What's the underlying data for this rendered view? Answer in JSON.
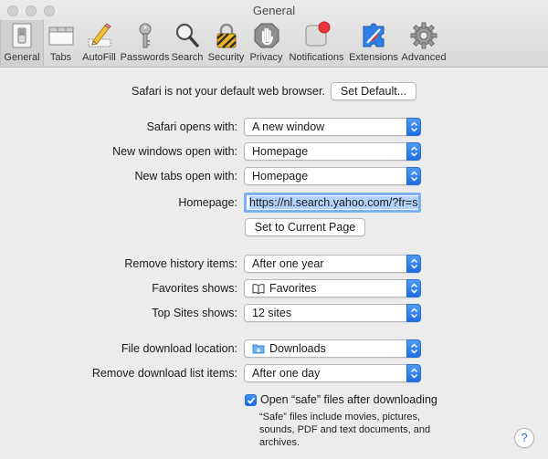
{
  "window": {
    "title": "General"
  },
  "toolbar": {
    "items": [
      {
        "label": "General",
        "icon": "general-switch-icon"
      },
      {
        "label": "Tabs",
        "icon": "tabs-icon"
      },
      {
        "label": "AutoFill",
        "icon": "autofill-pencil-icon"
      },
      {
        "label": "Passwords",
        "icon": "key-icon"
      },
      {
        "label": "Search",
        "icon": "magnifier-icon"
      },
      {
        "label": "Security",
        "icon": "padlock-icon"
      },
      {
        "label": "Privacy",
        "icon": "hand-icon"
      },
      {
        "label": "Notifications",
        "icon": "notification-badge-icon"
      },
      {
        "label": "Extensions",
        "icon": "puzzle-icon"
      },
      {
        "label": "Advanced",
        "icon": "gear-icon"
      }
    ]
  },
  "default_browser": {
    "message": "Safari is not your default web browser.",
    "button": "Set Default..."
  },
  "settings": {
    "opens_with": {
      "label": "Safari opens with:",
      "value": "A new window"
    },
    "new_windows": {
      "label": "New windows open with:",
      "value": "Homepage"
    },
    "new_tabs": {
      "label": "New tabs open with:",
      "value": "Homepage"
    },
    "homepage": {
      "label": "Homepage:",
      "value": "https://nl.search.yahoo.com/?fr=sp",
      "button": "Set to Current Page"
    },
    "remove_history": {
      "label": "Remove history items:",
      "value": "After one year"
    },
    "favorites_shows": {
      "label": "Favorites shows:",
      "value": "Favorites",
      "icon": "book-icon"
    },
    "top_sites": {
      "label": "Top Sites shows:",
      "value": "12 sites"
    },
    "download_location": {
      "label": "File download location:",
      "value": "Downloads",
      "icon": "downloads-folder-icon"
    },
    "remove_downloads": {
      "label": "Remove download list items:",
      "value": "After one day"
    },
    "open_safe": {
      "label": "Open “safe” files after downloading",
      "checked": true,
      "note": "“Safe” files include movies, pictures, sounds, PDF and text documents, and archives."
    }
  },
  "help": {
    "label": "?"
  },
  "colors": {
    "accent": "#1f6fe6",
    "background": "#ececec"
  }
}
